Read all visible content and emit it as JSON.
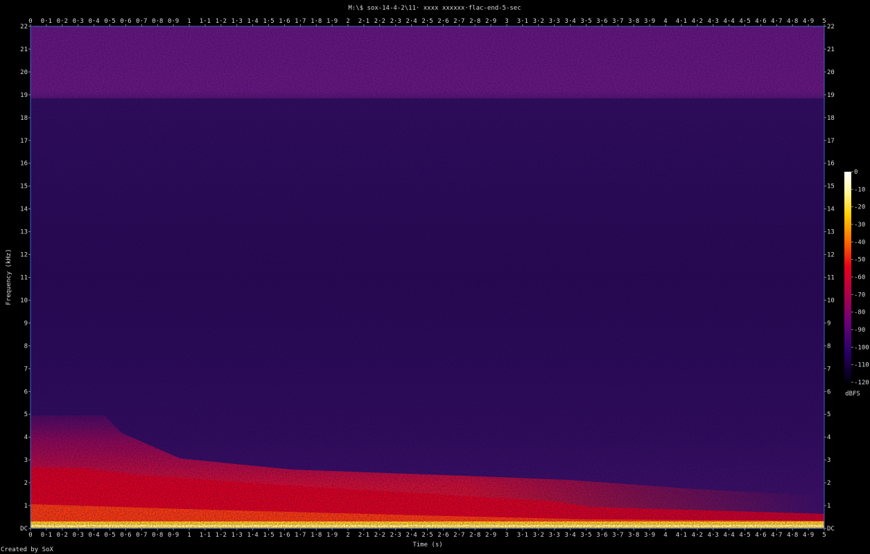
{
  "chart_data": {
    "type": "heatmap",
    "title": "M:\\$ sox-14-4-2\\11· xxxx xxxxxx·flac-end-5-sec",
    "xlabel": "Time (s)",
    "ylabel": "Frequency (kHz)",
    "xlim": [
      0,
      5
    ],
    "ylim": [
      0,
      22
    ],
    "x_ticks": [
      "0",
      "0·1",
      "0·2",
      "0·3",
      "0·4",
      "0·5",
      "0·6",
      "0·7",
      "0·8",
      "0·9",
      "1",
      "1·1",
      "1·2",
      "1·3",
      "1·4",
      "1·5",
      "1·6",
      "1·7",
      "1·8",
      "1·9",
      "2",
      "2·1",
      "2·2",
      "2·3",
      "2·4",
      "2·5",
      "2·6",
      "2·7",
      "2·8",
      "2·9",
      "3",
      "3·1",
      "3·2",
      "3·3",
      "3·4",
      "3·5",
      "3·6",
      "3·7",
      "3·8",
      "3·9",
      "4",
      "4·1",
      "4·2",
      "4·3",
      "4·4",
      "4·5",
      "4·6",
      "4·7",
      "4·8",
      "4·9",
      "5"
    ],
    "y_ticks": [
      "DC",
      "1",
      "2",
      "3",
      "4",
      "5",
      "6",
      "7",
      "8",
      "9",
      "10",
      "11",
      "12",
      "13",
      "14",
      "15",
      "16",
      "17",
      "18",
      "19",
      "20",
      "21",
      "22"
    ],
    "colorbar": {
      "label": "dBFS",
      "ticks": [
        "0",
        "-10",
        "-20",
        "-30",
        "-40",
        "-50",
        "-60",
        "-70",
        "-80",
        "-90",
        "-100",
        "-110",
        "-120"
      ],
      "range": [
        -120,
        0
      ]
    },
    "regions": [
      {
        "freq_khz": [
          19,
          22
        ],
        "time_s": [
          0,
          5
        ],
        "level_dbfs": -85
      },
      {
        "freq_khz": [
          6,
          19
        ],
        "time_s": [
          0,
          5
        ],
        "level_dbfs": -105
      },
      {
        "freq_khz": [
          0,
          5.5
        ],
        "time_s": [
          0,
          0.5
        ],
        "level_dbfs": -60
      },
      {
        "freq_khz": [
          0,
          2.5
        ],
        "time_s": [
          0,
          3.5
        ],
        "level_dbfs": -50
      },
      {
        "freq_khz": [
          0,
          0.3
        ],
        "time_s": [
          0,
          5
        ],
        "level_dbfs": -15
      }
    ]
  },
  "footer": {
    "credit": "Created by SoX"
  }
}
